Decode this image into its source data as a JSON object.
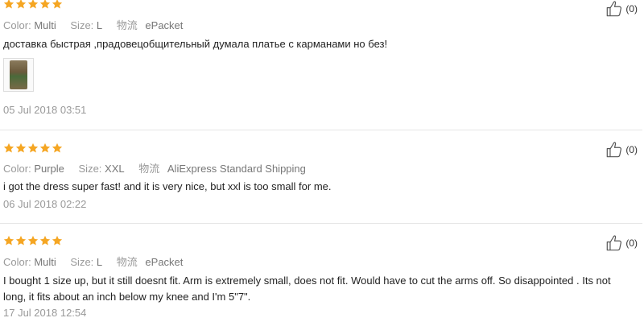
{
  "labels": {
    "color": "Color:",
    "size": "Size:",
    "shipping": "物流"
  },
  "colors": {
    "star": "#f5a623",
    "muted": "#999999"
  },
  "reviews": [
    {
      "rating": 5,
      "color": "Multi",
      "size": "L",
      "shipping": "ePacket",
      "text": "доставка быстрая ,прадовецобщительный думала платье с карманами но без!",
      "has_photo": true,
      "date": "05 Jul 2018 03:51",
      "helpful": "(0)"
    },
    {
      "rating": 5,
      "color": "Purple",
      "size": "XXL",
      "shipping": "AliExpress Standard Shipping",
      "text": "i got the dress super fast! and it is very nice, but xxl is too small for me.",
      "has_photo": false,
      "date": "06 Jul 2018 02:22",
      "helpful": "(0)"
    },
    {
      "rating": 5,
      "color": "Multi",
      "size": "L",
      "shipping": "ePacket",
      "text": "I bought 1 size up, but it still doesnt fit. Arm is extremely small, does not fit. Would have to cut the arms off. So disappointed . Its not long, it fits about an inch below my knee and I'm 5\"7\".",
      "has_photo": false,
      "date": "17 Jul 2018 12:54",
      "helpful": "(0)"
    }
  ]
}
